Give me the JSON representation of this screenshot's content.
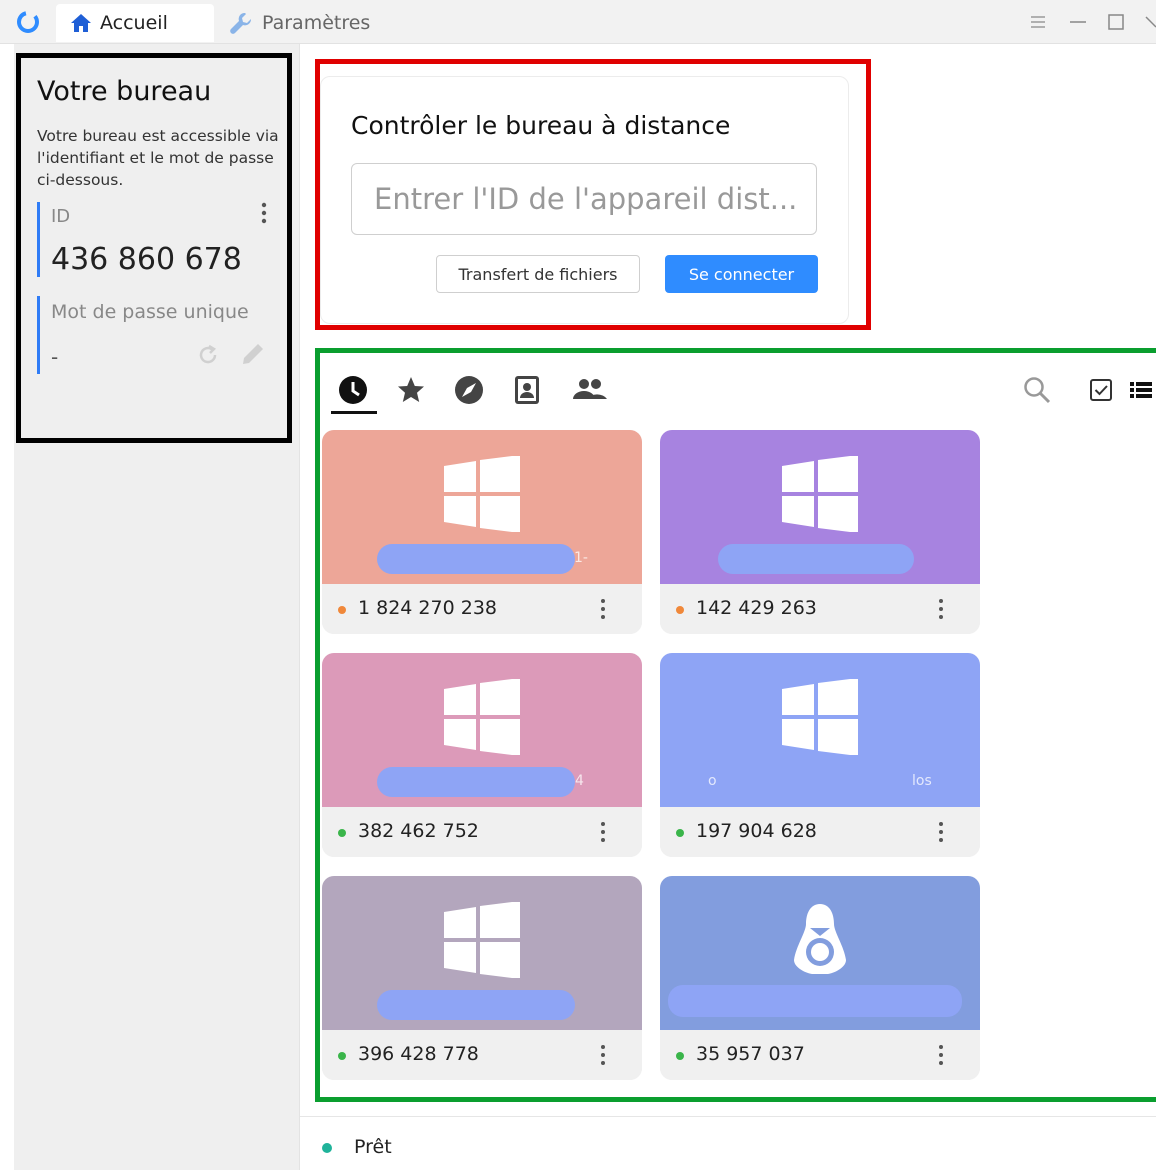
{
  "titlebar": {
    "tabs": [
      {
        "label": "Accueil",
        "icon": "home-icon"
      },
      {
        "label": "Paramètres",
        "icon": "wrench-icon"
      }
    ],
    "accent_color": "#2f7cf6"
  },
  "your_desktop": {
    "title": "Votre bureau",
    "description": "Votre bureau est accessible via l'identifiant et le mot de passe ci-dessous.",
    "id_label": "ID",
    "id_value": "436 860 678",
    "password_label": "Mot de passe unique",
    "password_value": "-"
  },
  "remote_control": {
    "title": "Contrôler le bureau à distance",
    "input_placeholder": "Entrer l'ID de l'appareil dist...",
    "file_transfer_label": "Transfert de fichiers",
    "connect_label": "Se connecter",
    "connect_color": "#2f8cff"
  },
  "peer_tabs": [
    "recent-icon",
    "favorites-icon",
    "discovered-icon",
    "address-book-icon",
    "group-icon"
  ],
  "peers": [
    {
      "id": "1 824 270 238",
      "os": "windows",
      "status_color": "#f0883a",
      "thumb_color": "#eda698",
      "tail": "1-"
    },
    {
      "id": "142 429 263",
      "os": "windows",
      "status_color": "#f0883a",
      "thumb_color": "#a783e0",
      "tail": ""
    },
    {
      "id": "382 462 752",
      "os": "windows",
      "status_color": "#3ab54a",
      "thumb_color": "#dc9ab9",
      "tail": "4"
    },
    {
      "id": "197 904 628",
      "os": "windows",
      "status_color": "#3ab54a",
      "thumb_color": "#8ea4f5",
      "tail_left": "o",
      "tail": "los"
    },
    {
      "id": "396 428 778",
      "os": "windows",
      "status_color": "#3ab54a",
      "thumb_color": "#b3a6bd",
      "tail": ""
    },
    {
      "id": "35 957 037",
      "os": "linux",
      "status_color": "#3ab54a",
      "thumb_color": "#829dde",
      "tail": ""
    }
  ],
  "status": {
    "text": "Prêt",
    "color": "#1fb39a"
  }
}
